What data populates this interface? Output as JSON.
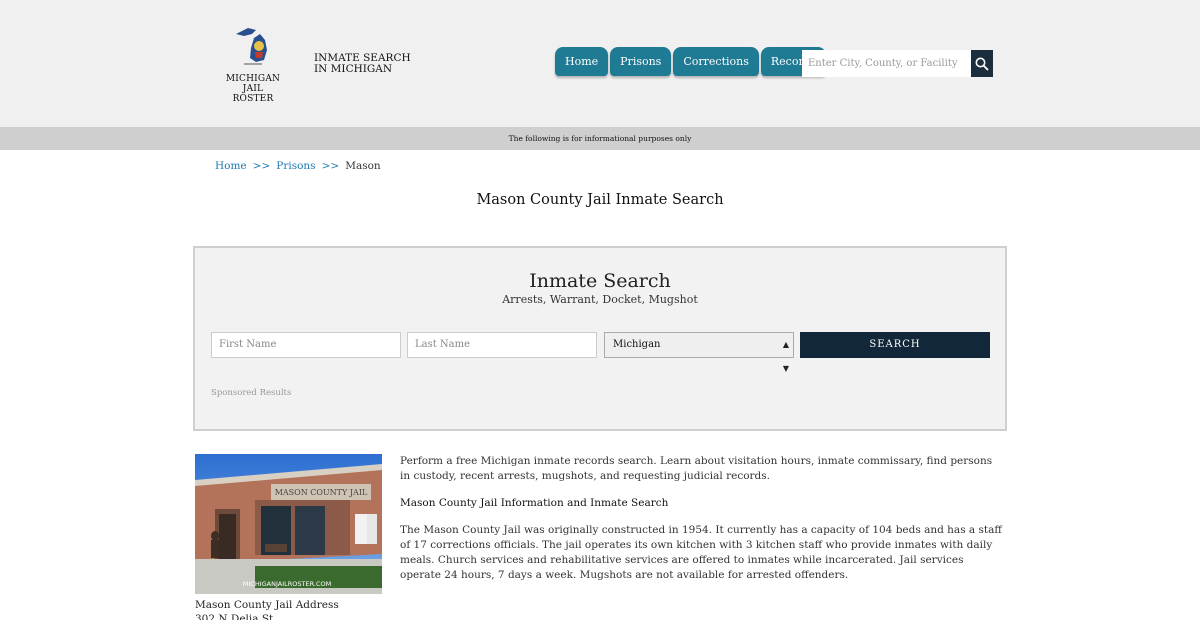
{
  "header": {
    "logo_text_line1": "MICHIGAN",
    "logo_text_line2": "JAIL ROSTER",
    "tagline": "INMATE SEARCH IN MICHIGAN",
    "nav": [
      "Home",
      "Prisons",
      "Corrections",
      "Records"
    ],
    "search_placeholder": "Enter City, County, or Facility"
  },
  "info_bar": "The following is for informational purposes only",
  "breadcrumb": {
    "items": [
      "Home",
      "Prisons",
      "Mason"
    ],
    "separator": ">>"
  },
  "page_title": "Mason County Jail Inmate Search",
  "search_panel": {
    "title": "Inmate Search",
    "subtitle": "Arrests, Warrant, Docket, Mugshot",
    "first_name_placeholder": "First Name",
    "last_name_placeholder": "Last Name",
    "state_selected": "Michigan",
    "submit_label": "SEARCH",
    "sponsored": "Sponsored Results"
  },
  "photo": {
    "sign_text": "MASON COUNTY JAIL",
    "watermark": "MICHIGANJAILROSTER.COM",
    "caption_line1": "Mason County Jail Address",
    "caption_line2": "302 N Delia St"
  },
  "content": {
    "intro": "Perform a free Michigan inmate records search. Learn about visitation hours, inmate commissary, find persons in custody, recent arrests, mugshots, and requesting judicial records.",
    "heading": "Mason County Jail Information and Inmate Search",
    "body": "The Mason County Jail was originally constructed in 1954. It currently has a capacity of 104 beds and has a staff of 17 corrections officials. The jail operates its own kitchen with 3 kitchen staff who provide inmates with daily meals. Church services and rehabilitative services are offered to inmates while incarcerated. Jail services operate 24 hours, 7 days a week. Mugshots are not available for arrested offenders."
  },
  "colors": {
    "nav_bg": "#1f7a93",
    "search_button_bg": "#1a2e3e",
    "submit_bg": "#12283a",
    "header_bg": "#f0f0f0",
    "info_bar_bg": "#cfcfcf"
  }
}
